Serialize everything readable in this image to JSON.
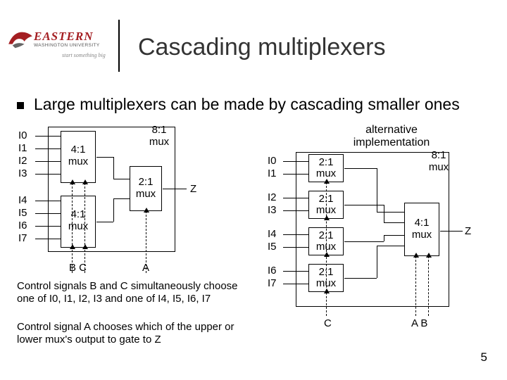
{
  "logo": {
    "word": "EASTERN",
    "sub": "WASHINGTON UNIVERSITY",
    "tag": "start something big"
  },
  "title": "Cascading multiplexers",
  "bullet": "Large multiplexers can be made by cascading smaller ones",
  "left": {
    "inputs": [
      "I0",
      "I1",
      "I2",
      "I3",
      "I4",
      "I5",
      "I6",
      "I7"
    ],
    "mux4_top": "4:1\nmux",
    "mux4_bot": "4:1\nmux",
    "mux2": "2:1\nmux",
    "mux8": "8:1\nmux",
    "sel_bc": "B  C",
    "sel_a": "A",
    "out": "Z"
  },
  "right": {
    "label": "alternative\nimplementation",
    "inputs": [
      "I0",
      "I1",
      "I2",
      "I3",
      "I4",
      "I5",
      "I6",
      "I7"
    ],
    "mux2": "2:1\nmux",
    "mux4": "4:1\nmux",
    "mux8": "8:1\nmux",
    "sel_c": "C",
    "sel_ab": "A  B",
    "out": "Z"
  },
  "notes": {
    "n1": "Control signals B and C simultaneously choose one of I0, I1, I2, I3 and one of I4, I5, I6, I7",
    "n2": "Control signal A chooses which of the upper or lower mux's output to gate to Z"
  },
  "page": "5"
}
